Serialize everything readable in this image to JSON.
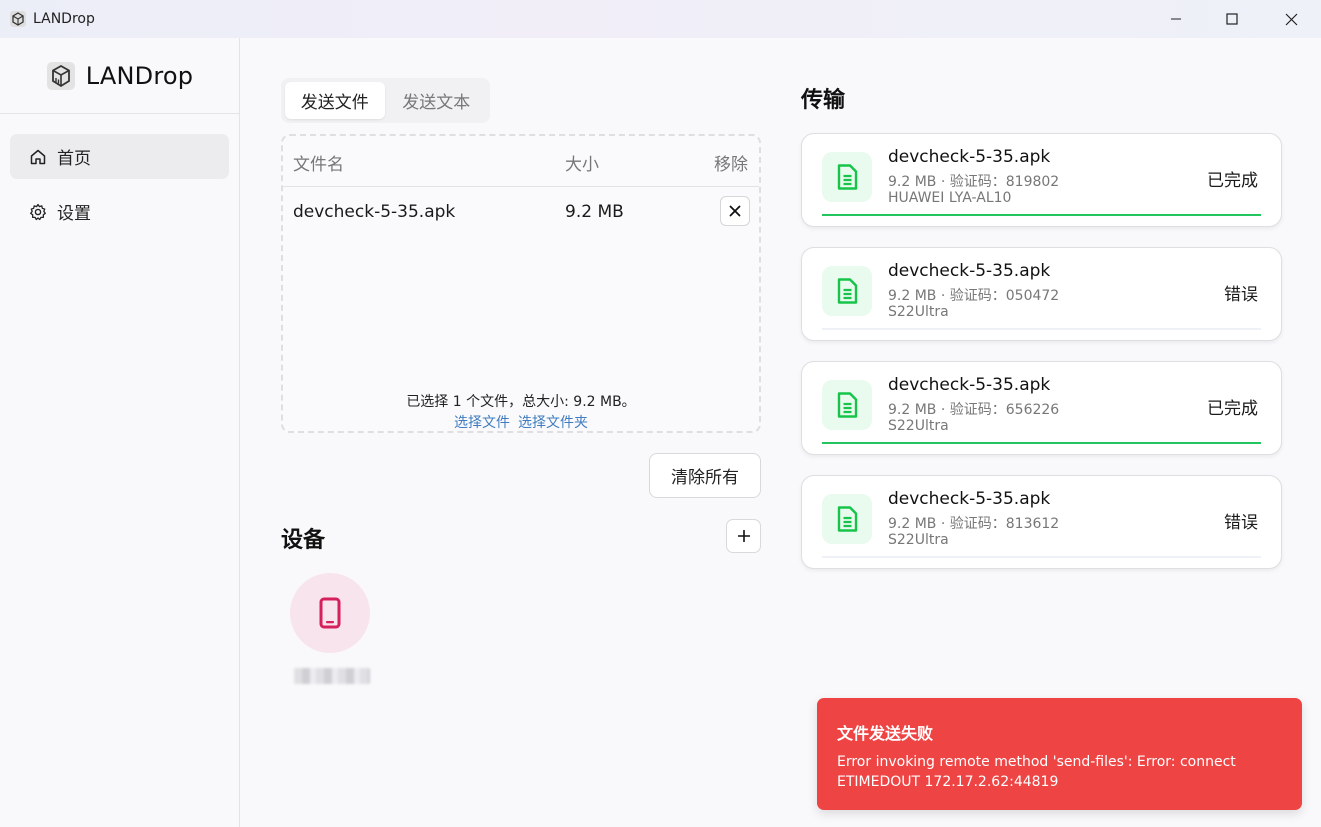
{
  "window": {
    "title": "LANDrop"
  },
  "sidebar": {
    "brand": "LANDrop",
    "items": [
      {
        "label": "首页",
        "icon": "home-icon",
        "active": true
      },
      {
        "label": "设置",
        "icon": "gear-icon",
        "active": false
      }
    ]
  },
  "send": {
    "tabs": [
      {
        "label": "发送文件",
        "active": true
      },
      {
        "label": "发送文本",
        "active": false
      }
    ],
    "table": {
      "headers": {
        "name": "文件名",
        "size": "大小",
        "remove": "移除"
      },
      "rows": [
        {
          "name": "devcheck-5-35.apk",
          "size": "9.2 MB"
        }
      ]
    },
    "summary": "已选择 1 个文件，总大小: 9.2 MB。",
    "select_file_label": "选择文件",
    "select_folder_label": "选择文件夹",
    "clear_all_label": "清除所有"
  },
  "devices": {
    "title": "设备",
    "items": [
      {
        "type": "phone",
        "icon": "smartphone-icon"
      }
    ]
  },
  "transfers": {
    "title": "传输",
    "items": [
      {
        "file": "devcheck-5-35.apk",
        "meta": "9.2 MB · 验证码：819802",
        "device": "HUAWEI LYA-AL10",
        "status": "已完成",
        "progress": 1.0
      },
      {
        "file": "devcheck-5-35.apk",
        "meta": "9.2 MB · 验证码：050472",
        "device": "S22Ultra",
        "status": "错误",
        "progress": 0.0
      },
      {
        "file": "devcheck-5-35.apk",
        "meta": "9.2 MB · 验证码：656226",
        "device": "S22Ultra",
        "status": "已完成",
        "progress": 1.0
      },
      {
        "file": "devcheck-5-35.apk",
        "meta": "9.2 MB · 验证码：813612",
        "device": "S22Ultra",
        "status": "错误",
        "progress": 0.0
      }
    ]
  },
  "toast": {
    "title": "文件发送失败",
    "message": "Error invoking remote method 'send-files': Error: connect ETIMEDOUT 172.17.2.62:44819"
  },
  "colors": {
    "accent_green": "#22c55e",
    "file_icon_green": "#16c44a",
    "toast_red": "#ef4444",
    "device_pink": "#d61f5d",
    "link_blue": "#3f7cc0"
  }
}
